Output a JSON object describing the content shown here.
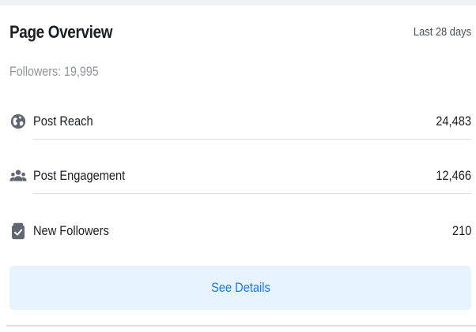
{
  "card": {
    "title": "Page Overview",
    "date_range": "Last 28 days",
    "followers_text": "Followers: 19,995"
  },
  "metrics": [
    {
      "icon": "globe-icon",
      "label": "Post Reach",
      "value": "24,483"
    },
    {
      "icon": "people-icon",
      "label": "Post Engagement",
      "value": "12,466"
    },
    {
      "icon": "checkbox-icon",
      "label": "New Followers",
      "value": "210"
    }
  ],
  "details_button": {
    "label": "See Details"
  },
  "colors": {
    "accent": "#1877f2",
    "button_bg": "#e7f3ff",
    "icon": "#606770",
    "muted_text": "#8d949e",
    "divider": "#dadde1"
  }
}
